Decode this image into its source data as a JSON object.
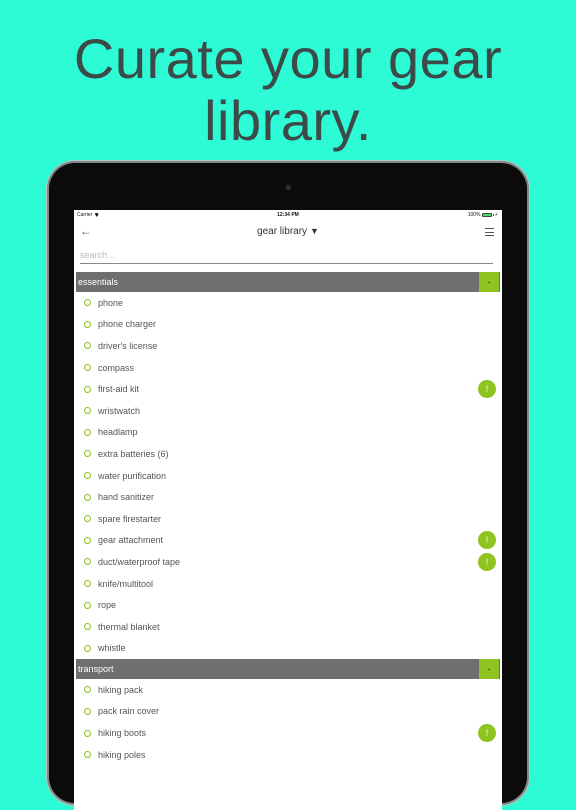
{
  "headline": {
    "line1": "Curate your gear",
    "line2": "library."
  },
  "status_bar": {
    "carrier": "Carrier",
    "time": "12:34 PM",
    "battery": "100%"
  },
  "nav": {
    "back_icon": "arrow-left-icon",
    "title": "gear library",
    "caret": "▼",
    "menu_icon": "hamburger-menu-icon"
  },
  "search": {
    "placeholder": "search..."
  },
  "colors": {
    "background": "#2dfbd6",
    "accent_green": "#8fc31f",
    "section_header": "#6f6f6f"
  },
  "sections": [
    {
      "title": "essentials",
      "collapse_label": "-",
      "items": [
        {
          "label": "phone",
          "alert": false
        },
        {
          "label": "phone charger",
          "alert": false
        },
        {
          "label": "driver's license",
          "alert": false
        },
        {
          "label": "compass",
          "alert": false
        },
        {
          "label": "first-aid kit",
          "alert": true
        },
        {
          "label": "wristwatch",
          "alert": false
        },
        {
          "label": "headlamp",
          "alert": false
        },
        {
          "label": "extra batteries (6)",
          "alert": false
        },
        {
          "label": "water purification",
          "alert": false
        },
        {
          "label": "hand sanitizer",
          "alert": false
        },
        {
          "label": "spare firestarter",
          "alert": false
        },
        {
          "label": "gear attachment",
          "alert": true
        },
        {
          "label": "duct/waterproof tape",
          "alert": true
        },
        {
          "label": "knife/multitool",
          "alert": false
        },
        {
          "label": "rope",
          "alert": false
        },
        {
          "label": "thermal blanket",
          "alert": false
        },
        {
          "label": "whistle",
          "alert": false
        }
      ]
    },
    {
      "title": "transport",
      "collapse_label": "-",
      "items": [
        {
          "label": "hiking pack",
          "alert": false
        },
        {
          "label": "pack rain cover",
          "alert": false
        },
        {
          "label": "hiking boots",
          "alert": true
        },
        {
          "label": "hiking poles",
          "alert": false
        }
      ]
    }
  ],
  "alert_symbol": "!"
}
